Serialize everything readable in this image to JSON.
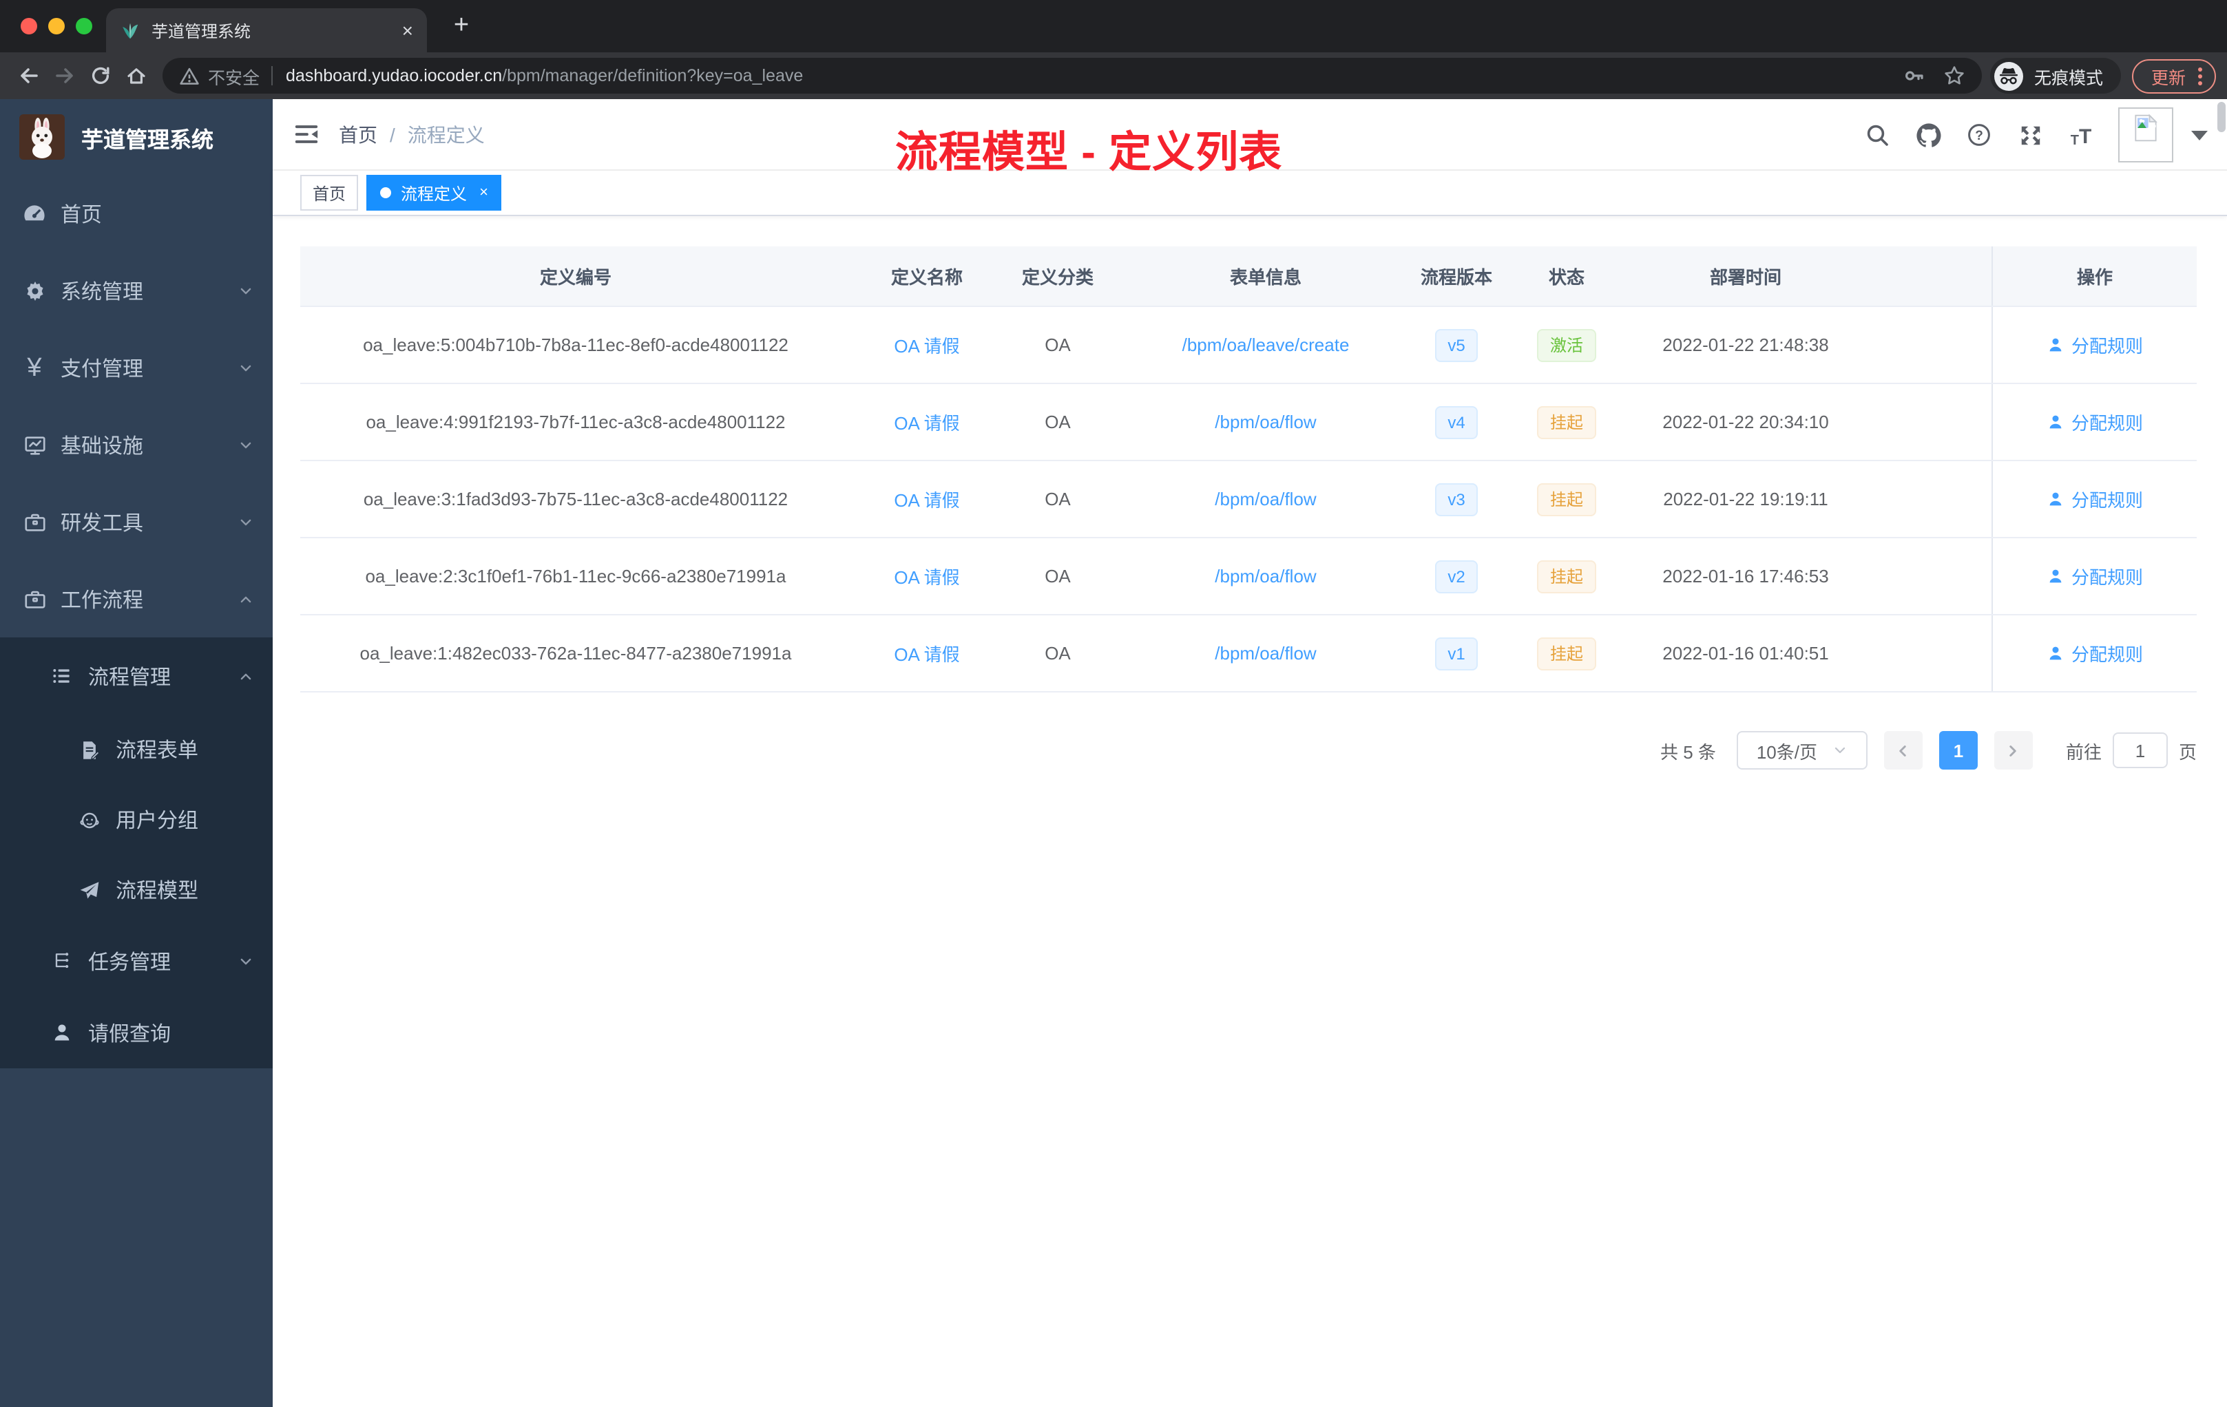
{
  "browser": {
    "tab_title": "芋道管理系统",
    "new_tab": "+",
    "close_tab": "×",
    "security_label": "不安全",
    "url_host": "dashboard.yudao.iocoder.cn",
    "url_path": "/bpm/manager/definition?key=oa_leave",
    "incognito_label": "无痕模式",
    "update_label": "更新"
  },
  "sidebar": {
    "app_title": "芋道管理系统",
    "menu": [
      {
        "label": "首页"
      },
      {
        "label": "系统管理"
      },
      {
        "label": "支付管理"
      },
      {
        "label": "基础设施"
      },
      {
        "label": "研发工具"
      },
      {
        "label": "工作流程"
      },
      {
        "label": "流程管理"
      },
      {
        "label": "流程表单"
      },
      {
        "label": "用户分组"
      },
      {
        "label": "流程模型"
      },
      {
        "label": "任务管理"
      },
      {
        "label": "请假查询"
      }
    ]
  },
  "header": {
    "breadcrumb_home": "首页",
    "breadcrumb_separator": "/",
    "breadcrumb_current": "流程定义",
    "annotation": "流程模型 - 定义列表"
  },
  "tags": {
    "home": "首页",
    "active": "流程定义",
    "close": "×"
  },
  "table": {
    "columns": {
      "id": "定义编号",
      "name": "定义名称",
      "category": "定义分类",
      "form": "表单信息",
      "version": "流程版本",
      "status": "状态",
      "deploy_time": "部署时间",
      "actions": "操作"
    },
    "action_label": "分配规则",
    "rows": [
      {
        "id": "oa_leave:5:004b710b-7b8a-11ec-8ef0-acde48001122",
        "name": "OA 请假",
        "category": "OA",
        "form": "/bpm/oa/leave/create",
        "version": "v5",
        "status": "激活",
        "deploy_time": "2022-01-22 21:48:38"
      },
      {
        "id": "oa_leave:4:991f2193-7b7f-11ec-a3c8-acde48001122",
        "name": "OA 请假",
        "category": "OA",
        "form": "/bpm/oa/flow",
        "version": "v4",
        "status": "挂起",
        "deploy_time": "2022-01-22 20:34:10"
      },
      {
        "id": "oa_leave:3:1fad3d93-7b75-11ec-a3c8-acde48001122",
        "name": "OA 请假",
        "category": "OA",
        "form": "/bpm/oa/flow",
        "version": "v3",
        "status": "挂起",
        "deploy_time": "2022-01-22 19:19:11"
      },
      {
        "id": "oa_leave:2:3c1f0ef1-76b1-11ec-9c66-a2380e71991a",
        "name": "OA 请假",
        "category": "OA",
        "form": "/bpm/oa/flow",
        "version": "v2",
        "status": "挂起",
        "deploy_time": "2022-01-16 17:46:53"
      },
      {
        "id": "oa_leave:1:482ec033-762a-11ec-8477-a2380e71991a",
        "name": "OA 请假",
        "category": "OA",
        "form": "/bpm/oa/flow",
        "version": "v1",
        "status": "挂起",
        "deploy_time": "2022-01-16 01:40:51"
      }
    ]
  },
  "pagination": {
    "total": "共 5 条",
    "page_size": "10条/页",
    "current_page": "1",
    "goto_label": "前往",
    "goto_value": "1",
    "page_unit": "页"
  },
  "colors": {
    "primary": "#409eff",
    "active_tag": "#1890ff",
    "success": "#67c23a",
    "warning": "#e6a23c",
    "annotation_red": "#f5222d",
    "sidebar_bg": "#304156",
    "submenu_bg": "#1f2d3d"
  }
}
